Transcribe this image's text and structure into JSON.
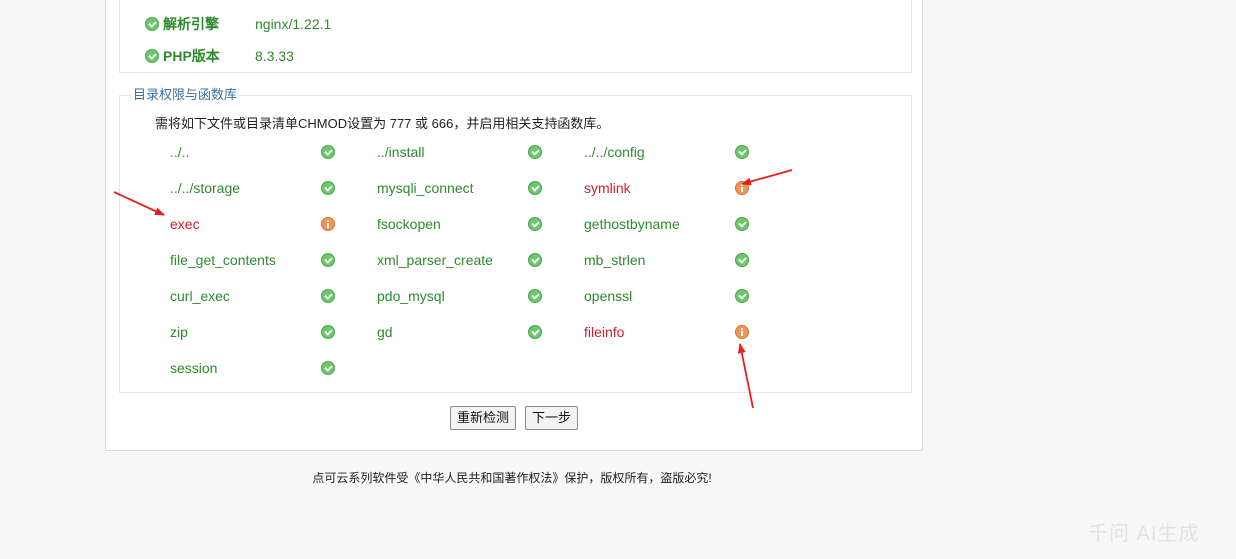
{
  "environment": {
    "rows": [
      {
        "label": "解析引擎",
        "value": "nginx/1.22.1"
      },
      {
        "label": "PHP版本",
        "value": "8.3.33"
      }
    ]
  },
  "permissions": {
    "title": "目录权限与函数库",
    "description": "需将如下文件或目录清单CHMOD设置为 777 或 666，并启用相关支持函数库。",
    "items": [
      {
        "name": "../..",
        "status": "ok"
      },
      {
        "name": "../install",
        "status": "ok"
      },
      {
        "name": "../../config",
        "status": "ok"
      },
      {
        "name": "../../storage",
        "status": "ok"
      },
      {
        "name": "mysqli_connect",
        "status": "ok"
      },
      {
        "name": "symlink",
        "status": "warn"
      },
      {
        "name": "exec",
        "status": "warn"
      },
      {
        "name": "fsockopen",
        "status": "ok"
      },
      {
        "name": "gethostbyname",
        "status": "ok"
      },
      {
        "name": "file_get_contents",
        "status": "ok"
      },
      {
        "name": "xml_parser_create",
        "status": "ok"
      },
      {
        "name": "mb_strlen",
        "status": "ok"
      },
      {
        "name": "curl_exec",
        "status": "ok"
      },
      {
        "name": "pdo_mysql",
        "status": "ok"
      },
      {
        "name": "openssl",
        "status": "ok"
      },
      {
        "name": "zip",
        "status": "ok"
      },
      {
        "name": "gd",
        "status": "ok"
      },
      {
        "name": "fileinfo",
        "status": "warn"
      },
      {
        "name": "session",
        "status": "ok"
      }
    ]
  },
  "buttons": {
    "recheck": "重新检测",
    "next": "下一步"
  },
  "footer": {
    "text": "点可云系列软件受《中华人民共和国著作权法》保护，版权所有，盗版必究!"
  },
  "watermark": {
    "text": "千问 AI生成"
  },
  "colors": {
    "ok": "#2d8a2d",
    "bad": "#d0202a",
    "warn_icon": "#f0955a",
    "ok_icon": "#6cc86c",
    "arrow": "#e8201c",
    "title": "#3b6fa0"
  }
}
